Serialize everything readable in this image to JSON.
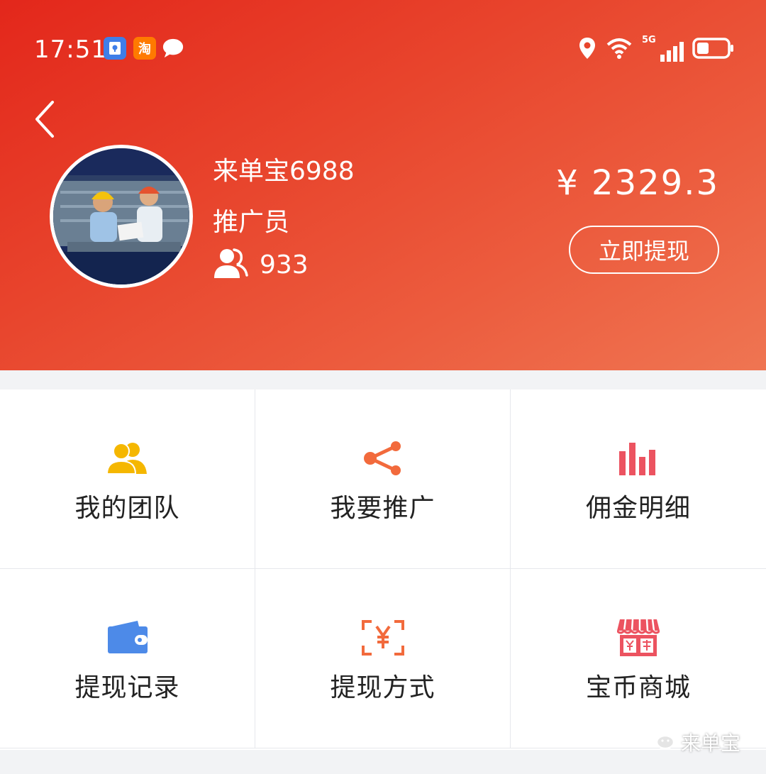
{
  "status_bar": {
    "time": "17:51",
    "app_icons": [
      "shield-app-icon",
      "taobao-app-icon",
      "chat-bubble-icon"
    ],
    "taobao_label": "淘",
    "signal_label": "5G"
  },
  "header": {
    "user_name": "来单宝6988",
    "user_role": "推广员",
    "team_count": "933",
    "balance": "¥ 2329.3",
    "withdraw_label": "立即提现"
  },
  "menu": {
    "items": [
      {
        "label": "我的团队",
        "icon": "team-icon",
        "color": "#f5b700"
      },
      {
        "label": "我要推广",
        "icon": "share-icon",
        "color": "#f26a3c"
      },
      {
        "label": "佣金明细",
        "icon": "bar-chart-icon",
        "color": "#ec5360"
      },
      {
        "label": "提现记录",
        "icon": "wallet-icon",
        "color": "#4d8ae8"
      },
      {
        "label": "提现方式",
        "icon": "yuan-scan-icon",
        "color": "#f26a3c"
      },
      {
        "label": "宝币商城",
        "icon": "store-icon",
        "color": "#ec5360"
      }
    ]
  },
  "watermark": {
    "label": "来单宝"
  },
  "colors": {
    "header_start": "#e3271b",
    "header_end": "#ef7552",
    "background": "#f2f3f5"
  }
}
